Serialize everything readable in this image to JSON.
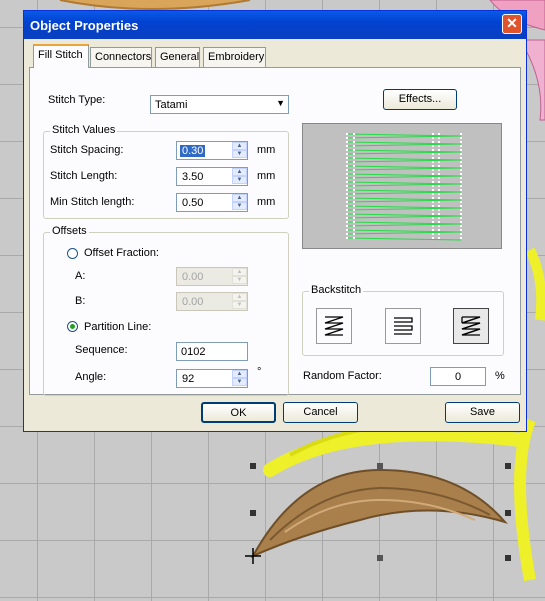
{
  "window": {
    "title": "Object Properties"
  },
  "tabs": [
    {
      "label": "Fill Stitch",
      "active": true
    },
    {
      "label": "Connectors",
      "active": false
    },
    {
      "label": "General",
      "active": false
    },
    {
      "label": "Embroidery",
      "active": false
    }
  ],
  "fill": {
    "stitch_type_label": "Stitch Type:",
    "stitch_type_value": "Tatami",
    "effects_button": "Effects...",
    "stitch_values": {
      "title": "Stitch Values",
      "spacing_label": "Stitch Spacing:",
      "spacing_value": "0.30",
      "length_label": "Stitch Length:",
      "length_value": "3.50",
      "min_label": "Min Stitch length:",
      "min_value": "0.50",
      "unit": "mm"
    },
    "offsets": {
      "title": "Offsets",
      "offset_fraction_label": "Offset Fraction:",
      "a_label": "A:",
      "a_value": "0.00",
      "b_label": "B:",
      "b_value": "0.00",
      "partition_label": "Partition Line:",
      "sequence_label": "Sequence:",
      "sequence_value": "0102",
      "angle_label": "Angle:",
      "angle_value": "92",
      "angle_unit": "°"
    },
    "backstitch": {
      "title": "Backstitch",
      "selected_index": 2
    },
    "random_factor_label": "Random Factor:",
    "random_factor_value": "0",
    "random_factor_unit": "%"
  },
  "buttons": {
    "ok": "OK",
    "cancel": "Cancel",
    "save": "Save"
  },
  "colors": {
    "titlebar": "#0a5ae8",
    "stitch_preview": "#22dd44",
    "preview_bg": "#c0c0c0"
  }
}
